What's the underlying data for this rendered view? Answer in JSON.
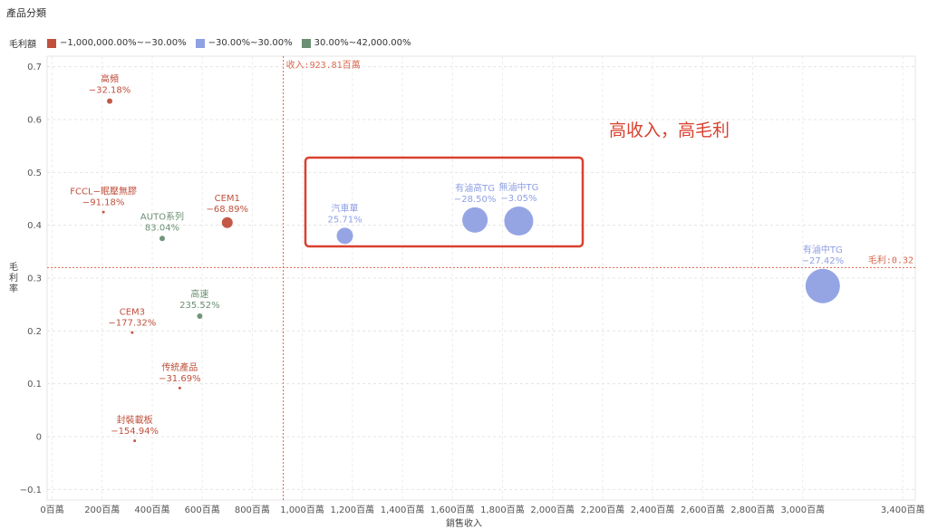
{
  "header": {
    "title": "產品分類"
  },
  "legend": {
    "title": "毛利額",
    "items": [
      {
        "label": "−1,000,000.00%~−30.00%",
        "color": "#c0503c"
      },
      {
        "label": "−30.00%~30.00%",
        "color": "#8fa0e3"
      },
      {
        "label": "30.00%~42,000.00%",
        "color": "#6a8f72"
      }
    ]
  },
  "annotation": {
    "text": "高收入，高毛利",
    "color": "#d9412e"
  },
  "chart_data": {
    "type": "scatter",
    "xlabel": "銷售收入",
    "ylabel": "毛利率",
    "xlim": [
      -20,
      3450
    ],
    "ylim": [
      -0.12,
      0.72
    ],
    "x_ticks": [
      0,
      200,
      400,
      600,
      800,
      1000,
      1200,
      1400,
      1600,
      1800,
      2000,
      2200,
      2400,
      2600,
      2800,
      3000,
      3400
    ],
    "x_tick_labels": [
      "0百萬",
      "200百萬",
      "400百萬",
      "600百萬",
      "800百萬",
      "1,000百萬",
      "1,200百萬",
      "1,400百萬",
      "1,600百萬",
      "1,800百萬",
      "2,000百萬",
      "2,200百萬",
      "2,400百萬",
      "2,600百萬",
      "2,800百萬",
      "3,000百萬",
      "3,400百萬"
    ],
    "y_ticks": [
      -0.1,
      0,
      0.1,
      0.2,
      0.3,
      0.4,
      0.5,
      0.6,
      0.7
    ],
    "y_tick_labels": [
      "−0.1",
      "0",
      "0.1",
      "0.2",
      "0.3",
      "0.4",
      "0.5",
      "0.6",
      "0.7"
    ],
    "grid": true,
    "reference_lines": [
      {
        "axis": "x",
        "value": 923.81,
        "label": "收入:923.81百萬"
      },
      {
        "axis": "y",
        "value": 0.32,
        "label": "毛利:0.32"
      }
    ],
    "points": [
      {
        "name": "高頻",
        "pct": "−32.18%",
        "x": 230,
        "y": 0.635,
        "group": 0,
        "size": 3
      },
      {
        "name": "FCCL−眠壓無膠",
        "pct": "−91.18%",
        "x": 205,
        "y": 0.425,
        "group": 0,
        "size": 1.5
      },
      {
        "name": "CEM1",
        "pct": "−68.89%",
        "x": 700,
        "y": 0.405,
        "group": 0,
        "size": 6
      },
      {
        "name": "AUTO系列",
        "pct": "83.04%",
        "x": 440,
        "y": 0.375,
        "group": 2,
        "size": 3
      },
      {
        "name": "高速",
        "pct": "235.52%",
        "x": 590,
        "y": 0.228,
        "group": 2,
        "size": 3
      },
      {
        "name": "CEM3",
        "pct": "−177.32%",
        "x": 320,
        "y": 0.197,
        "group": 0,
        "size": 1.5
      },
      {
        "name": "传統產品",
        "pct": "−31.69%",
        "x": 510,
        "y": 0.092,
        "group": 0,
        "size": 1.5
      },
      {
        "name": "封裝載板",
        "pct": "−154.94%",
        "x": 330,
        "y": -0.008,
        "group": 0,
        "size": 1.5
      },
      {
        "name": "汽車單",
        "pct": "25.71%",
        "x": 1170,
        "y": 0.38,
        "group": 1,
        "size": 9
      },
      {
        "name": "有滷高TG",
        "pct": "−28.50%",
        "x": 1690,
        "y": 0.41,
        "group": 1,
        "size": 14
      },
      {
        "name": "無滷中TG",
        "pct": "−3.05%",
        "x": 1865,
        "y": 0.408,
        "group": 1,
        "size": 16
      },
      {
        "name": "有滷中TG",
        "pct": "−27.42%",
        "x": 3080,
        "y": 0.285,
        "group": 1,
        "size": 19
      }
    ]
  }
}
